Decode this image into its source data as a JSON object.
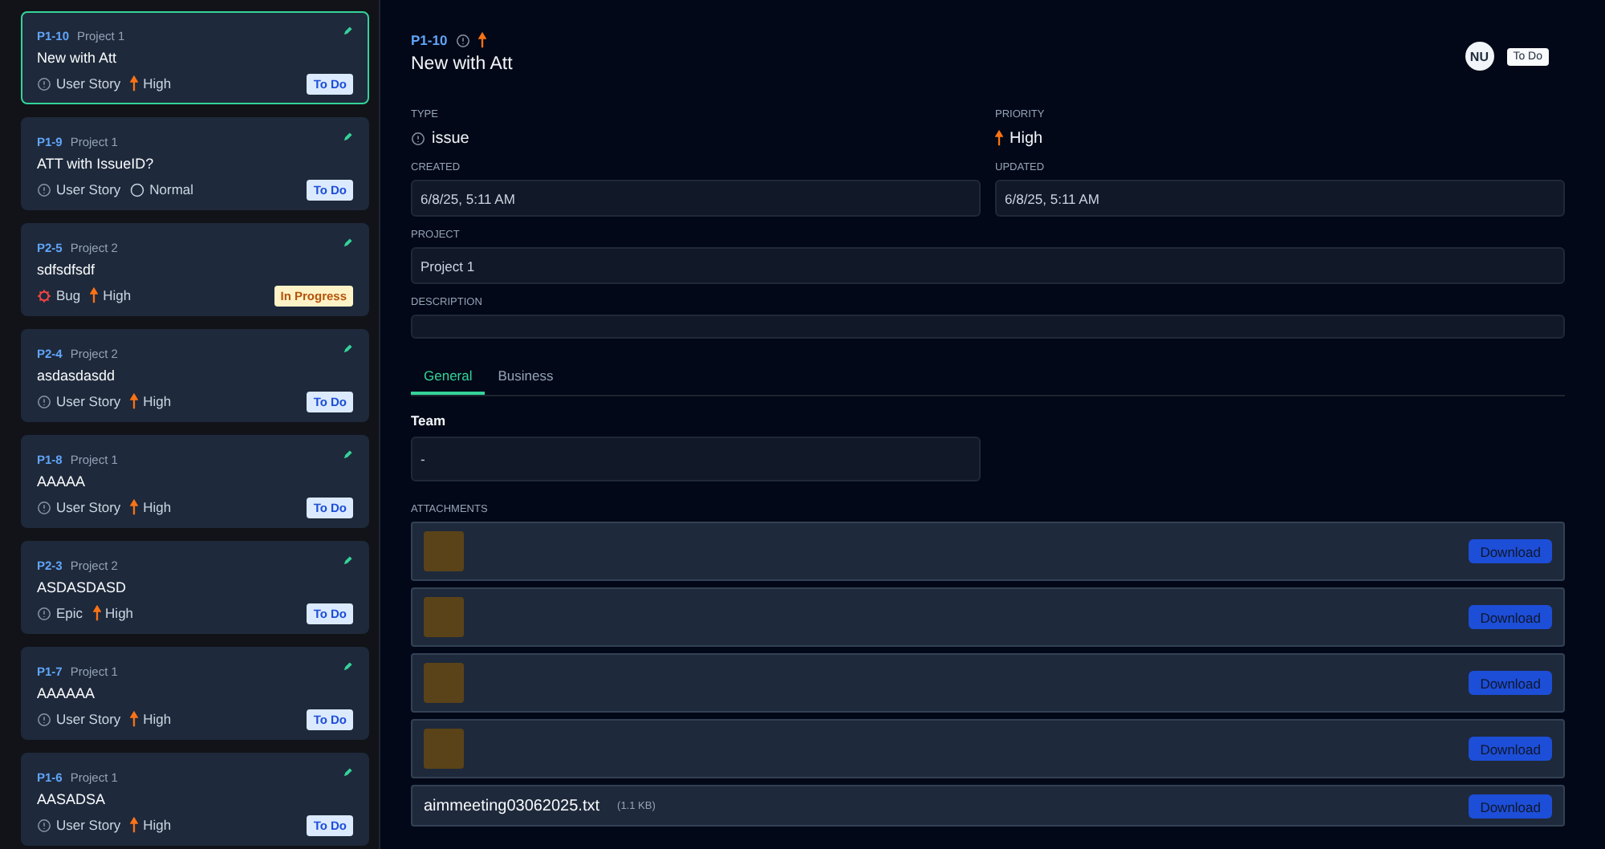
{
  "issue_list": [
    {
      "key": "P1-10",
      "project": "Project 1",
      "title": "New with Att",
      "type": {
        "kind": "story",
        "label": "User Story"
      },
      "priority": {
        "kind": "high",
        "label": "High"
      },
      "status": {
        "kind": "todo",
        "label": "To Do"
      },
      "selected": true
    },
    {
      "key": "P1-9",
      "project": "Project 1",
      "title": "ATT with IssueID?",
      "type": {
        "kind": "story",
        "label": "User Story"
      },
      "priority": {
        "kind": "normal",
        "label": "Normal"
      },
      "status": {
        "kind": "todo",
        "label": "To Do"
      },
      "selected": false
    },
    {
      "key": "P2-5",
      "project": "Project 2",
      "title": "sdfsdfsdf",
      "type": {
        "kind": "bug",
        "label": "Bug"
      },
      "priority": {
        "kind": "high",
        "label": "High"
      },
      "status": {
        "kind": "progress",
        "label": "In Progress"
      },
      "selected": false
    },
    {
      "key": "P2-4",
      "project": "Project 2",
      "title": "asdasdasdd",
      "type": {
        "kind": "story",
        "label": "User Story"
      },
      "priority": {
        "kind": "high",
        "label": "High"
      },
      "status": {
        "kind": "todo",
        "label": "To Do"
      },
      "selected": false
    },
    {
      "key": "P1-8",
      "project": "Project 1",
      "title": "AAAAA",
      "type": {
        "kind": "story",
        "label": "User Story"
      },
      "priority": {
        "kind": "high",
        "label": "High"
      },
      "status": {
        "kind": "todo",
        "label": "To Do"
      },
      "selected": false
    },
    {
      "key": "P2-3",
      "project": "Project 2",
      "title": "ASDASDASD",
      "type": {
        "kind": "epic",
        "label": "Epic"
      },
      "priority": {
        "kind": "high",
        "label": "High"
      },
      "status": {
        "kind": "todo",
        "label": "To Do"
      },
      "selected": false
    },
    {
      "key": "P1-7",
      "project": "Project 1",
      "title": "AAAAAA",
      "type": {
        "kind": "story",
        "label": "User Story"
      },
      "priority": {
        "kind": "high",
        "label": "High"
      },
      "status": {
        "kind": "todo",
        "label": "To Do"
      },
      "selected": false
    },
    {
      "key": "P1-6",
      "project": "Project 1",
      "title": "AASADSA",
      "type": {
        "kind": "story",
        "label": "User Story"
      },
      "priority": {
        "kind": "high",
        "label": "High"
      },
      "status": {
        "kind": "todo",
        "label": "To Do"
      },
      "selected": false
    }
  ],
  "detail": {
    "key": "P1-10",
    "title": "New with Att",
    "assignee": "NU",
    "status": "To Do",
    "type": {
      "label": "TYPE",
      "value": "issue"
    },
    "priority": {
      "label": "PRIORITY",
      "kind": "high",
      "value": "High"
    },
    "created": {
      "label": "CREATED",
      "value": "6/8/25, 5:11 AM"
    },
    "updated": {
      "label": "UPDATED",
      "value": "6/8/25, 5:11 AM"
    },
    "project": {
      "label": "PROJECT",
      "value": "Project 1"
    },
    "description": {
      "label": "DESCRIPTION"
    },
    "tabs": [
      {
        "label": "General",
        "selected": true
      },
      {
        "label": "Business",
        "selected": false
      }
    ],
    "team": {
      "label": "Team",
      "value": "-"
    },
    "attachments_label": "ATTACHMENTS",
    "attachments": [
      {
        "kind": "image",
        "button": "Download"
      },
      {
        "kind": "image",
        "button": "Download"
      },
      {
        "kind": "image",
        "button": "Download"
      },
      {
        "kind": "image",
        "button": "Download"
      },
      {
        "kind": "file",
        "name": "aimmeeting03062025.txt",
        "size": "(1.1 KB)",
        "button": "Download"
      }
    ]
  }
}
